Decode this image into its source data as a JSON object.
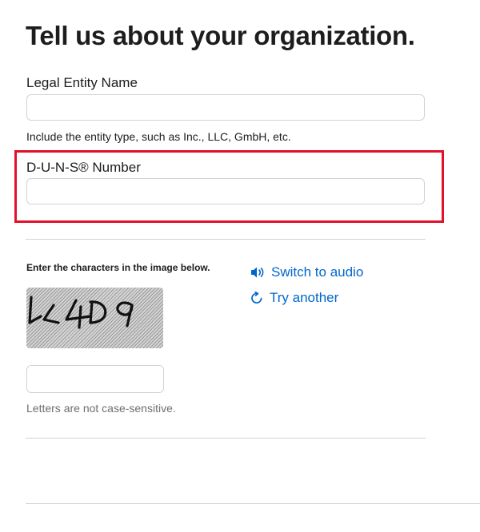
{
  "page": {
    "title": "Tell us about your organization."
  },
  "legal_entity": {
    "label": "Legal Entity Name",
    "value": "",
    "hint": "Include the entity type, such as Inc., LLC, GmbH, etc."
  },
  "duns": {
    "label": "D-U-N-S® Number",
    "value": "",
    "highlight_color": "#e2102b"
  },
  "captcha": {
    "instruction": "Enter the characters in the image below.",
    "image_text": "LL4D9",
    "switch_audio_label": "Switch to audio",
    "switch_audio_icon": "speaker-icon",
    "try_another_label": "Try another",
    "try_another_icon": "refresh-icon",
    "input_value": "",
    "case_hint": "Letters are not case-sensitive."
  },
  "colors": {
    "link": "#0066cc",
    "text": "#1d1d1f",
    "muted_text": "#6e6e73",
    "border": "#d2d2d7"
  }
}
